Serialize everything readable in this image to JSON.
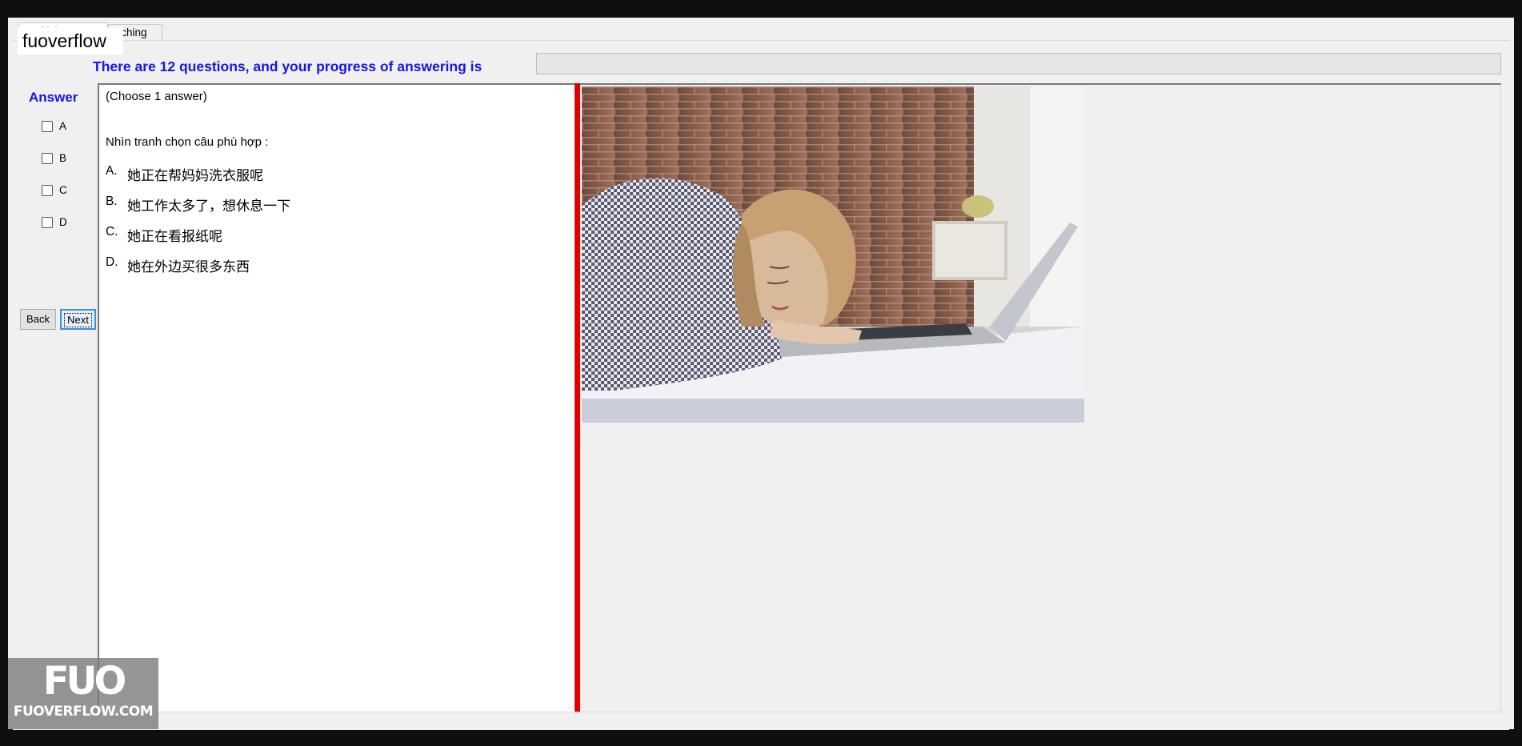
{
  "tabs": [
    {
      "label": "Multiple Choices"
    },
    {
      "label": "atching"
    }
  ],
  "brand_overlay": "fuoverflow",
  "progress": {
    "label": "There are 12 questions, and your progress of answering is",
    "value_percent": 0
  },
  "answer": {
    "title": "Answer",
    "options": [
      "A",
      "B",
      "C",
      "D"
    ]
  },
  "buttons": {
    "back": "Back",
    "next": "Next"
  },
  "question": {
    "instruction": "(Choose 1 answer)",
    "prompt": "Nhìn tranh chọn câu phù hợp :",
    "choices": [
      {
        "letter": "A.",
        "text": "她正在帮妈妈洗衣服呢"
      },
      {
        "letter": "B.",
        "text": "她工作太多了，想休息一下"
      },
      {
        "letter": "C.",
        "text": "她正在看报纸呢"
      },
      {
        "letter": "D.",
        "text": "她在外边买很多东西"
      }
    ]
  },
  "image": {
    "description_icon": "photo-woman-sleeping-on-laptop"
  },
  "watermark": {
    "logo": "FUO",
    "site": "FUOVERFLOW.COM"
  },
  "colors": {
    "accent_blue": "#1616e8",
    "splitter_red": "#e10000",
    "window_bg": "#f0f0f0"
  }
}
